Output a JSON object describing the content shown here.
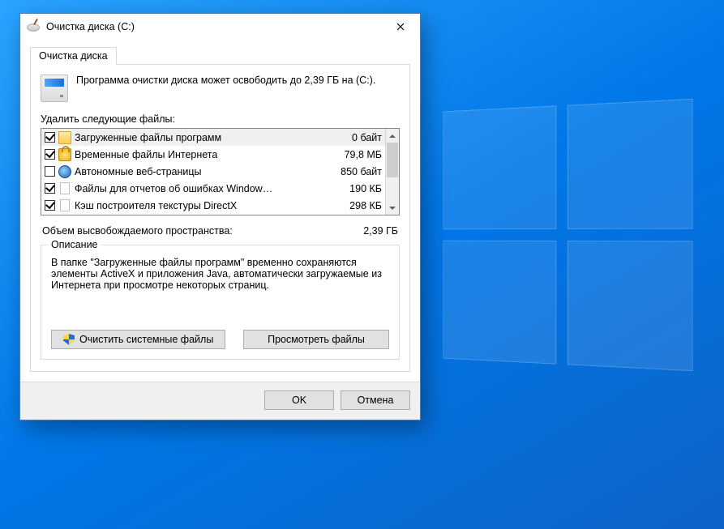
{
  "window": {
    "title": "Очистка диска  (C:)"
  },
  "tab": {
    "label": "Очистка диска"
  },
  "intro": {
    "text": "Программа очистки диска может освободить до 2,39 ГБ на (C:)."
  },
  "section": {
    "delete_label": "Удалить следующие файлы:",
    "total_label": "Объем высвобождаемого пространства:",
    "total_value": "2,39 ГБ"
  },
  "files": [
    {
      "checked": true,
      "icon": "folder",
      "label": "Загруженные файлы программ",
      "size": "0 байт",
      "selected": true
    },
    {
      "checked": true,
      "icon": "lock",
      "label": "Временные файлы Интернета",
      "size": "79,8 МБ",
      "selected": false
    },
    {
      "checked": false,
      "icon": "globe",
      "label": "Автономные веб-страницы",
      "size": "850 байт",
      "selected": false
    },
    {
      "checked": true,
      "icon": "file",
      "label": "Файлы для отчетов об ошибках Window…",
      "size": "190 КБ",
      "selected": false
    },
    {
      "checked": true,
      "icon": "file",
      "label": "Кэш построителя текстуры DirectX",
      "size": "298 КБ",
      "selected": false
    }
  ],
  "description": {
    "legend": "Описание",
    "text": "В папке \"Загруженные файлы программ\" временно сохраняются элементы ActiveX и приложения Java, автоматически загружаемые из Интернета при просмотре некоторых страниц."
  },
  "buttons": {
    "clean_system": "Очистить системные файлы",
    "view_files": "Просмотреть файлы",
    "ok": "OK",
    "cancel": "Отмена"
  }
}
